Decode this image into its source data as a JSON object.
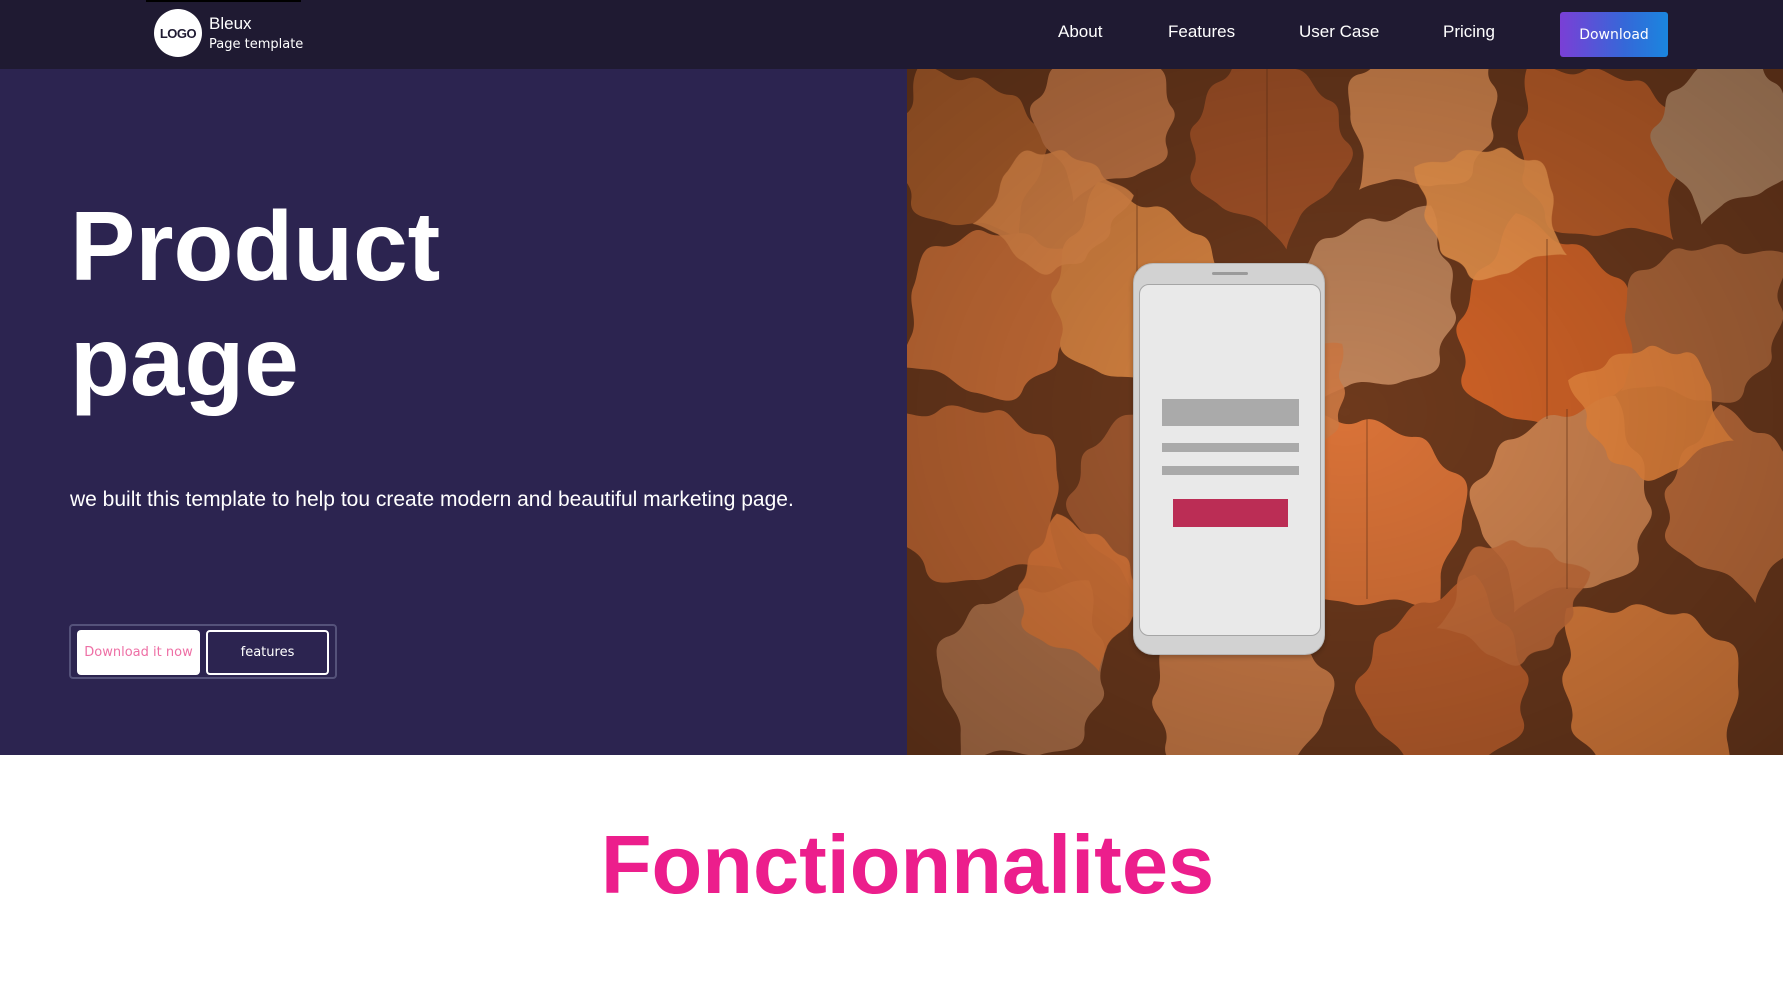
{
  "brand": {
    "logo_text": "LOGO",
    "name": "Bleux",
    "subtitle": "Page template"
  },
  "nav": {
    "links": [
      "About",
      "Features",
      "User Case",
      "Pricing"
    ],
    "download_label": "Download"
  },
  "hero": {
    "title_line1": "Product",
    "title_line2": "page",
    "description": "we built this template to help tou create modern and beautiful marketing page.",
    "primary_button": "Download it now",
    "secondary_button": "features"
  },
  "features": {
    "title": "Fonctionnalites"
  },
  "colors": {
    "nav_bg": "#1f1a32",
    "hero_bg": "#2c2450",
    "accent_pink": "#ec1e8c",
    "download_gradient_start": "#7a3fd6",
    "download_gradient_end": "#1a86df",
    "phone_button": "#bb2d55"
  },
  "icons": {
    "logo": "logo-badge",
    "hero_image": "autumn-leaves-photo",
    "device": "smartphone-mockup"
  }
}
